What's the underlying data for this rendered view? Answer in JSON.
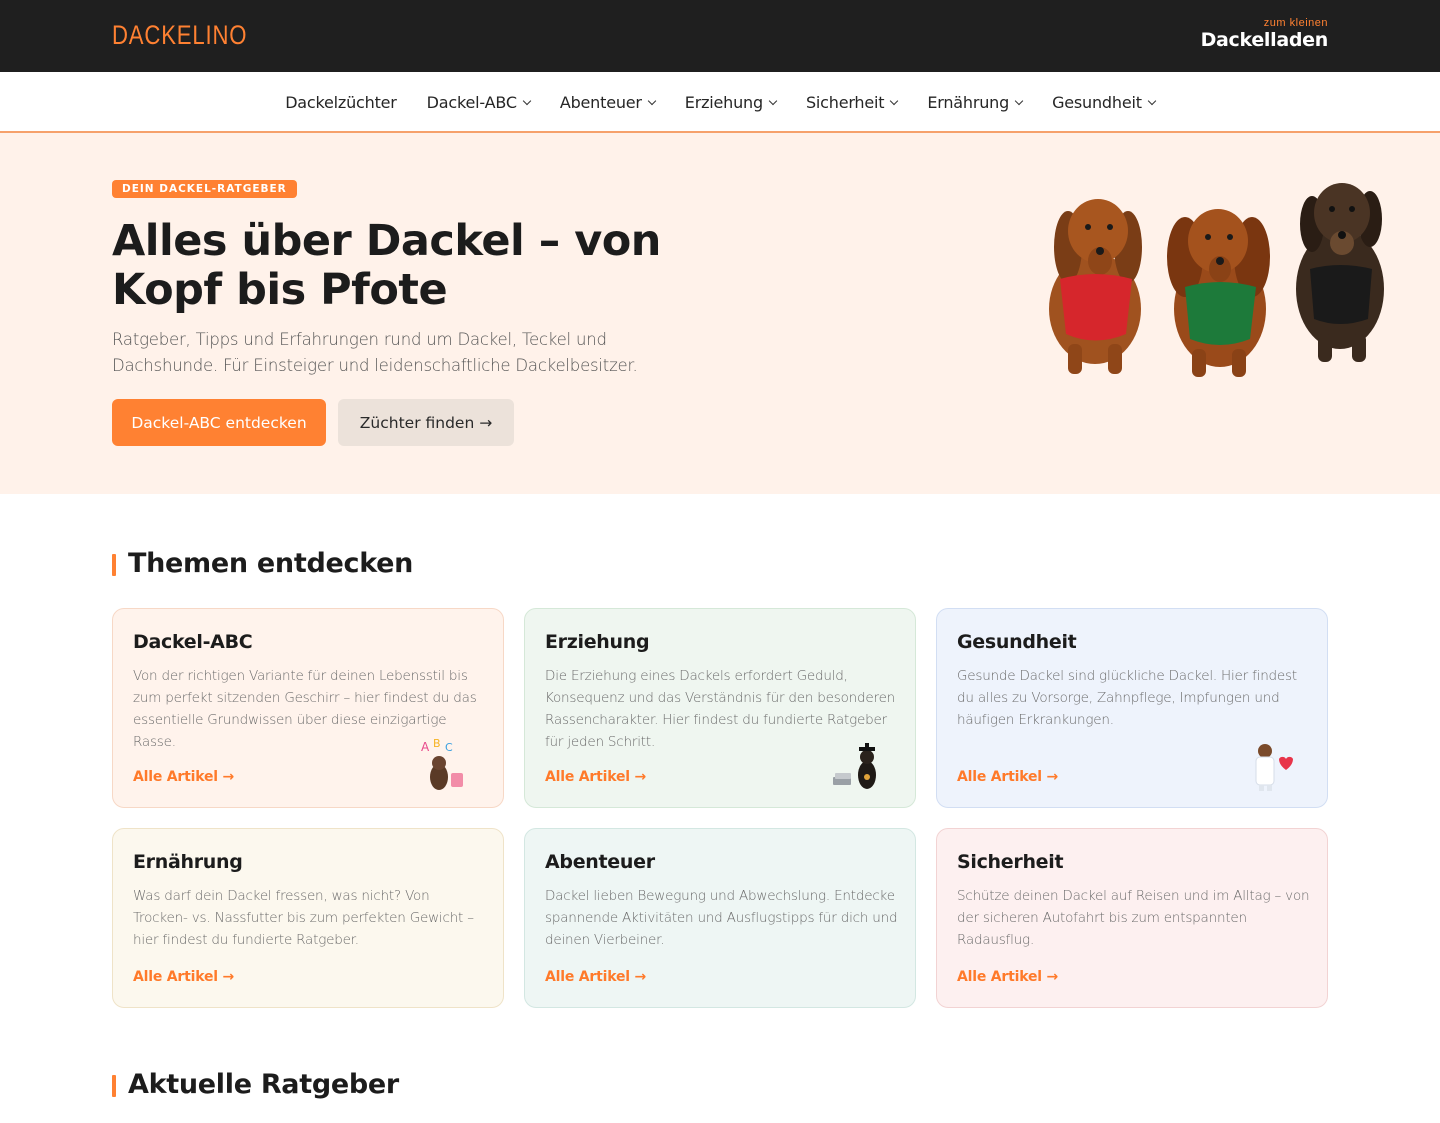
{
  "header": {
    "logo": "DACKELINO",
    "shop_small": "zum kleinen",
    "shop_big": "Dackelladen"
  },
  "nav": {
    "items": [
      {
        "label": "Dackelzüchter",
        "dropdown": false
      },
      {
        "label": "Dackel-ABC",
        "dropdown": true
      },
      {
        "label": "Abenteuer",
        "dropdown": true
      },
      {
        "label": "Erziehung",
        "dropdown": true
      },
      {
        "label": "Sicherheit",
        "dropdown": true
      },
      {
        "label": "Ernährung",
        "dropdown": true
      },
      {
        "label": "Gesundheit",
        "dropdown": true
      }
    ]
  },
  "hero": {
    "badge": "DEIN DACKEL-RATGEBER",
    "title": "Alles über Dackel – von Kopf bis Pfote",
    "subtitle": "Ratgeber, Tipps und Erfahrungen rund um Dackel, Teckel und Dachshunde. Für Einsteiger und leidenschaftliche Dackelbesitzer.",
    "primary_button": "Dackel-ABC entdecken",
    "secondary_button": "Züchter finden →"
  },
  "topics": {
    "title": "Themen entdecken",
    "cards": [
      {
        "title": "Dackel-ABC",
        "text": "Von der richtigen Variante für deinen Lebensstil bis zum perfekt sitzenden Geschirr – hier findest du das essentielle Grundwissen über diese einzigartige Rasse.",
        "link": "Alle Artikel →",
        "illustration": "abc-dog-icon"
      },
      {
        "title": "Erziehung",
        "text": "Die Erziehung eines Dackels erfordert Geduld, Konsequenz und das Verständnis für den besonderen Rassencharakter. Hier findest du fundierte Ratgeber für jeden Schritt.",
        "link": "Alle Artikel →",
        "illustration": "graduate-dog-icon"
      },
      {
        "title": "Gesundheit",
        "text": "Gesunde Dackel sind glückliche Dackel. Hier findest du alles zu Vorsorge, Zahnpflege, Impfungen und häufigen Erkrankungen.",
        "link": "Alle Artikel →",
        "illustration": "vet-dog-icon"
      },
      {
        "title": "Ernährung",
        "text": "Was darf dein Dackel fressen, was nicht? Von Trocken- vs. Nassfutter bis zum perfekten Gewicht – hier findest du fundierte Ratgeber.",
        "link": "Alle Artikel →"
      },
      {
        "title": "Abenteuer",
        "text": "Dackel lieben Bewegung und Abwechslung. Entdecke spannende Aktivitäten und Ausflugstipps für dich und deinen Vierbeiner.",
        "link": "Alle Artikel →"
      },
      {
        "title": "Sicherheit",
        "text": "Schütze deinen Dackel auf Reisen und im Alltag – von der sicheren Autofahrt bis zum entspannten Radausflug.",
        "link": "Alle Artikel →"
      }
    ]
  },
  "latest": {
    "title": "Aktuelle Ratgeber"
  },
  "colors": {
    "accent": "#ff8132",
    "topbar": "#1f1f1f",
    "hero_bg": "#fff2ea"
  }
}
